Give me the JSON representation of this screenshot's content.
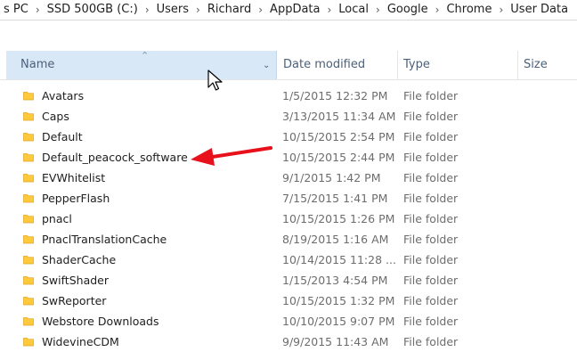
{
  "breadcrumb": [
    "s PC",
    "SSD 500GB (C:)",
    "Users",
    "Richard",
    "AppData",
    "Local",
    "Google",
    "Chrome",
    "User Data"
  ],
  "columns": {
    "name": "Name",
    "date": "Date modified",
    "type": "Type",
    "size": "Size"
  },
  "sort_column": "Name",
  "folder_icon_color": "#ffc93c",
  "annotation_arrow_color": "#e8101a",
  "rows": [
    {
      "name": "Avatars",
      "date": "1/5/2015 12:32 PM",
      "type": "File folder"
    },
    {
      "name": "Caps",
      "date": "3/13/2015 11:34 AM",
      "type": "File folder"
    },
    {
      "name": "Default",
      "date": "10/15/2015 2:54 PM",
      "type": "File folder"
    },
    {
      "name": "Default_peacock_software",
      "date": "10/15/2015 2:44 PM",
      "type": "File folder"
    },
    {
      "name": "EVWhitelist",
      "date": "9/1/2015 1:42 PM",
      "type": "File folder"
    },
    {
      "name": "PepperFlash",
      "date": "7/15/2015 1:41 PM",
      "type": "File folder"
    },
    {
      "name": "pnacl",
      "date": "10/15/2015 1:26 PM",
      "type": "File folder"
    },
    {
      "name": "PnaclTranslationCache",
      "date": "8/19/2015 1:16 AM",
      "type": "File folder"
    },
    {
      "name": "ShaderCache",
      "date": "10/14/2015 11:28 ...",
      "type": "File folder"
    },
    {
      "name": "SwiftShader",
      "date": "1/15/2013 4:54 PM",
      "type": "File folder"
    },
    {
      "name": "SwReporter",
      "date": "10/15/2015 1:32 PM",
      "type": "File folder"
    },
    {
      "name": "Webstore Downloads",
      "date": "10/10/2015 9:07 PM",
      "type": "File folder"
    },
    {
      "name": "WidevineCDM",
      "date": "9/9/2015 11:43 AM",
      "type": "File folder"
    }
  ]
}
